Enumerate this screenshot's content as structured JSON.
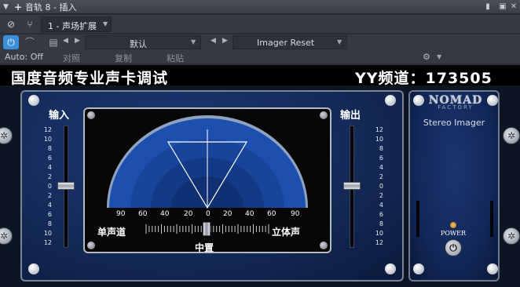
{
  "titlebar": {
    "title": "音轨 8 - 插入"
  },
  "insert": {
    "slot_label": "1 - 声场扩展"
  },
  "preset": {
    "default_label": "默认",
    "name": "Imager Reset"
  },
  "auto": {
    "label": "Auto: Off"
  },
  "edit": {
    "compare": "对照",
    "copy": "复制",
    "paste": "粘贴"
  },
  "banner": {
    "left": "国度音频专业声卡调试",
    "right": "YY频道：173505"
  },
  "plugin": {
    "input_label": "输入",
    "output_label": "输出",
    "fader_scale": [
      "12",
      "10",
      "8",
      "6",
      "4",
      "2",
      "0",
      "2",
      "4",
      "6",
      "8",
      "10",
      "12"
    ],
    "width_scale": [
      "90",
      "60",
      "40",
      "20",
      "0",
      "20",
      "40",
      "60",
      "90"
    ],
    "mono_label": "单声道",
    "stereo_label": "立体声",
    "center_label": "中置",
    "brand_line1": "NOMAD",
    "brand_line2": "FACTORY",
    "product_name": "Stereo Imager",
    "power_label": "POWER"
  },
  "state": {
    "input_gain_db": 0,
    "output_gain_db": 0,
    "width_position": 0
  }
}
